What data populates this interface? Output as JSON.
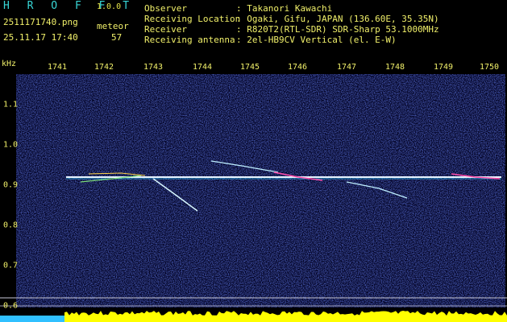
{
  "app": {
    "title": "H R O F F T",
    "version": "1.0.0"
  },
  "capture": {
    "filename": "2511171740.png",
    "datetime": "25.11.17 17:40",
    "meteor_label": "meteor",
    "meteor_count": "57"
  },
  "info": [
    {
      "label": "Observer",
      "value": ": Takanori Kawachi"
    },
    {
      "label": "Receiving Location",
      "value": ": Ogaki, Gifu, JAPAN (136.60E, 35.35N)"
    },
    {
      "label": "Receiver",
      "value": ": R820T2(RTL-SDR) SDR-Sharp 53.1000MHz"
    },
    {
      "label": "Receiving antenna",
      "value": ": 2el-HB9CV Vertical (el. E-W)"
    }
  ],
  "axis": {
    "unit": "kHz",
    "time_ticks": [
      "1741",
      "1742",
      "1743",
      "1744",
      "1745",
      "1746",
      "1747",
      "1748",
      "1749",
      "1750"
    ],
    "freq_ticks": [
      "1.1",
      "1.0",
      "0.9",
      "0.8",
      "0.7",
      "0.6"
    ]
  },
  "colors": {
    "background": "#000020",
    "label": "#f1f06a",
    "title": "#38d7d7",
    "trace": "#ffffff",
    "level": "#ffff00",
    "baseline": "#30c0ff"
  }
}
